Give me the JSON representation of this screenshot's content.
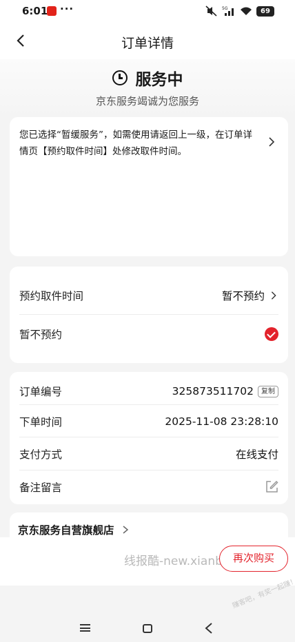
{
  "status_bar": {
    "time": "6:01",
    "dots": "···",
    "network": "5G",
    "battery": "69"
  },
  "nav": {
    "title": "订单详情"
  },
  "hero": {
    "status": "服务中",
    "subtitle": "京东服务竭诚为您服务"
  },
  "notice": {
    "text": "您已选择“暂缓服务”，如需使用请返回上一级，在订单详情页【预约取件时间】处修改取件时间。"
  },
  "pickup": {
    "time_label": "预约取件时间",
    "time_value": "暂不预约",
    "option_label": "暂不预约"
  },
  "order": {
    "number_label": "订单编号",
    "number_value": "325873511702",
    "copy_label": "复制",
    "time_label": "下单时间",
    "time_value": "2025-11-08 23:28:10",
    "payment_label": "支付方式",
    "payment_value": "在线支付",
    "remark_label": "备注留言"
  },
  "store": {
    "name": "京东服务自营旗舰店"
  },
  "bottom": {
    "rebuy_label": "再次购买",
    "watermark": "线报酷-new.xianbao.fun",
    "watermark2": "赚客吧，有奖一起赚！www.zuanke8.com"
  },
  "icons": {
    "back": "back-arrow-icon",
    "clock": "clock-icon",
    "chevron": "chevron-right-icon",
    "check": "check-circle-icon",
    "edit": "edit-icon"
  },
  "colors": {
    "accent": "#e3232c",
    "background": "#f4f4f4",
    "card": "#ffffff"
  }
}
